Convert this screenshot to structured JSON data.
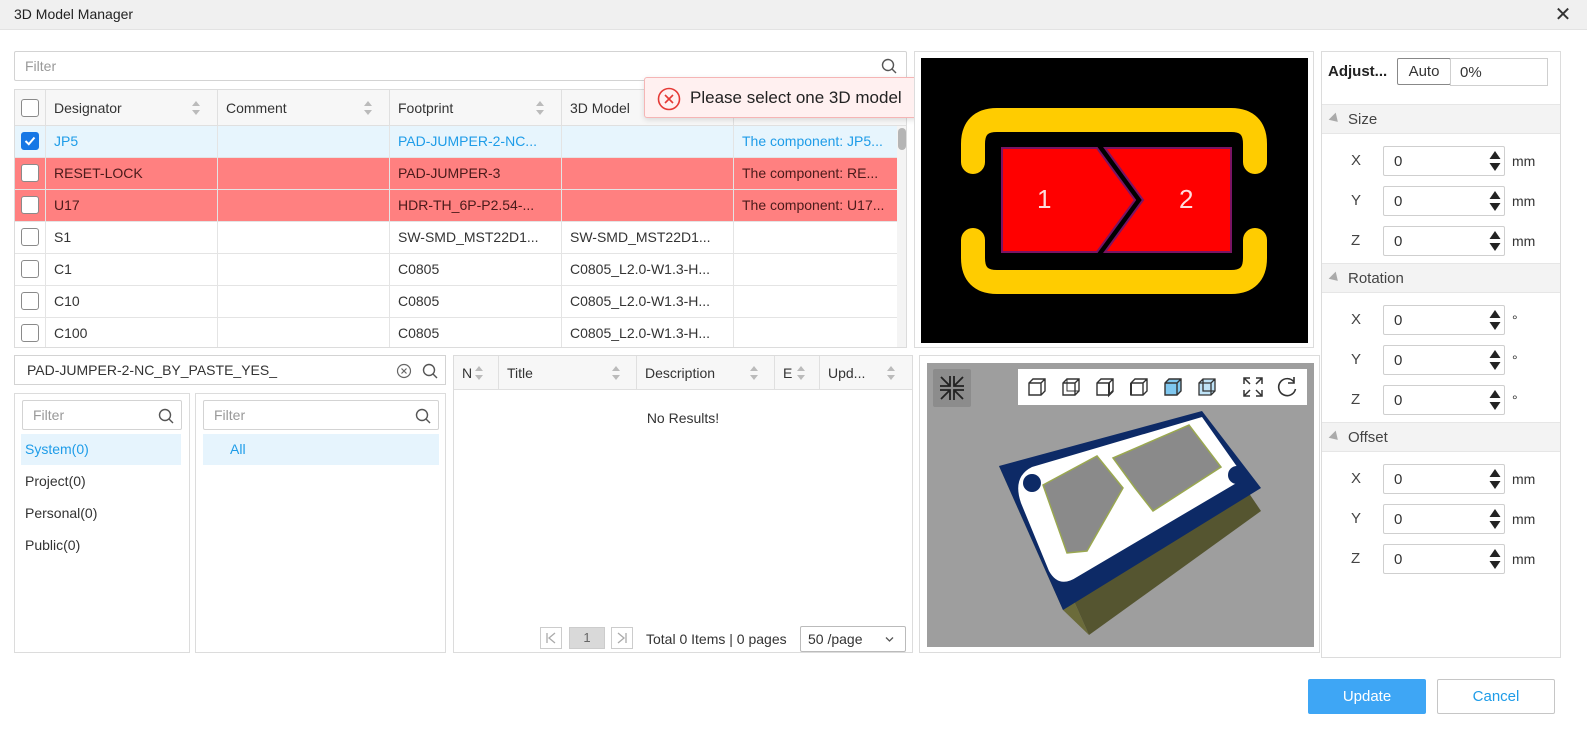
{
  "window": {
    "title": "3D Model Manager"
  },
  "filter_top": {
    "placeholder": "Filter"
  },
  "table": {
    "columns": [
      "Designator",
      "Comment",
      "Footprint",
      "3D Model"
    ],
    "rows": [
      {
        "designator": "JP5",
        "comment": "",
        "footprint": "PAD-JUMPER-2-NC...",
        "model": "",
        "message": "The component: JP5...",
        "checked": true,
        "state": "selected"
      },
      {
        "designator": "RESET-LOCK",
        "comment": "",
        "footprint": "PAD-JUMPER-3",
        "model": "",
        "message": "The component: RE...",
        "checked": false,
        "state": "error"
      },
      {
        "designator": "U17",
        "comment": "",
        "footprint": "HDR-TH_6P-P2.54-...",
        "model": "",
        "message": "The component: U17...",
        "checked": false,
        "state": "error"
      },
      {
        "designator": "S1",
        "comment": "",
        "footprint": "SW-SMD_MST22D1...",
        "model": "SW-SMD_MST22D1...",
        "message": "",
        "checked": false,
        "state": "normal"
      },
      {
        "designator": "C1",
        "comment": "",
        "footprint": "C0805",
        "model": "C0805_L2.0-W1.3-H...",
        "message": "",
        "checked": false,
        "state": "normal"
      },
      {
        "designator": "C10",
        "comment": "",
        "footprint": "C0805",
        "model": "C0805_L2.0-W1.3-H...",
        "message": "",
        "checked": false,
        "state": "normal"
      },
      {
        "designator": "C100",
        "comment": "",
        "footprint": "C0805",
        "model": "C0805_L2.0-W1.3-H...",
        "message": "",
        "checked": false,
        "state": "normal"
      }
    ]
  },
  "toast": {
    "message": "Please select one 3D model"
  },
  "footprint_preview": {
    "pad1": "1",
    "pad2": "2"
  },
  "search": {
    "value": "PAD-JUMPER-2-NC_BY_PASTE_YES_"
  },
  "library": {
    "filter_placeholder": "Filter",
    "items": [
      "System(0)",
      "Project(0)",
      "Personal(0)",
      "Public(0)"
    ],
    "active_index": 0
  },
  "category": {
    "filter_placeholder": "Filter",
    "items": [
      "All"
    ]
  },
  "results": {
    "columns": [
      "N",
      "Title",
      "Description",
      "E",
      "Upd..."
    ],
    "empty_text": "No Results!",
    "page": "1",
    "summary": "Total 0 Items | 0 pages",
    "page_size": "50 /page"
  },
  "adjust": {
    "label": "Adjust...",
    "auto_label": "Auto",
    "percent": "0%",
    "sections": [
      {
        "title": "Size",
        "unit": "mm",
        "fields": [
          {
            "axis": "X",
            "value": "0"
          },
          {
            "axis": "Y",
            "value": "0"
          },
          {
            "axis": "Z",
            "value": "0"
          }
        ]
      },
      {
        "title": "Rotation",
        "unit": "°",
        "fields": [
          {
            "axis": "X",
            "value": "0"
          },
          {
            "axis": "Y",
            "value": "0"
          },
          {
            "axis": "Z",
            "value": "0"
          }
        ]
      },
      {
        "title": "Offset",
        "unit": "mm",
        "fields": [
          {
            "axis": "X",
            "value": "0"
          },
          {
            "axis": "Y",
            "value": "0"
          },
          {
            "axis": "Z",
            "value": "0"
          }
        ]
      }
    ]
  },
  "buttons": {
    "update": "Update",
    "cancel": "Cancel"
  },
  "colors": {
    "accent": "#1e9ce8",
    "error_row": "#ff8080",
    "selected_row": "#e7f5fd",
    "primary_button": "#3ea6f5"
  }
}
